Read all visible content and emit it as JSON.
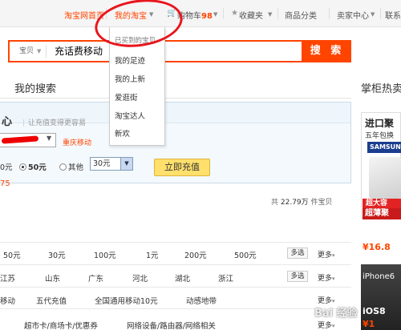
{
  "topnav": {
    "home": "淘宝网首页",
    "my_taobao": "我的淘宝",
    "cart_label": "购物车",
    "cart_count": "98",
    "favorites": "收藏夹",
    "categories": "商品分类",
    "seller_center": "卖家中心",
    "contact": "联系"
  },
  "search": {
    "type": "宝贝",
    "query": "充话费移动",
    "button": "搜 索"
  },
  "dropdown": {
    "items": [
      "已买到的宝贝",
      "我的足迹",
      "我的上新",
      "爱逛街",
      "淘宝达人",
      "新欢"
    ]
  },
  "main": {
    "title": "我的搜索",
    "recharge": {
      "title": "心",
      "subtitle": "让充值变得更容易",
      "carrier": "重庆移动",
      "options": [
        "0元",
        "50元",
        "其他"
      ],
      "selected_amount": "30元",
      "button": "立即充值",
      "price": "75"
    },
    "count_prefix": "共",
    "count_value": "22.79万",
    "count_suffix": "件宝贝"
  },
  "filters": {
    "multi": "多选",
    "more": "更多",
    "row1": [
      "50元",
      "30元",
      "100元",
      "1元",
      "200元",
      "500元"
    ],
    "row2": [
      "江苏",
      "山东",
      "广东",
      "河北",
      "湖北",
      "浙江"
    ],
    "row3": [
      "移动",
      "五代充值",
      "全国通用移动10元",
      "动感地带"
    ],
    "row4": [
      "超市卡/商场卡/优惠券",
      "网络设备/路由器/网络相关"
    ]
  },
  "right": {
    "title": "掌柜热卖",
    "ad1_title": "进口聚",
    "ad1_sub": "五年包换",
    "ad1_brand": "SAMSUNG",
    "ad1_red1": "超大容",
    "ad1_red2": "超薄聚",
    "ad1_price": "¥16.8",
    "ad2_t1": "iPhone6",
    "ad2_t2": "iOS8",
    "ad2_price": "¥1"
  },
  "watermark": "Bai 经验"
}
